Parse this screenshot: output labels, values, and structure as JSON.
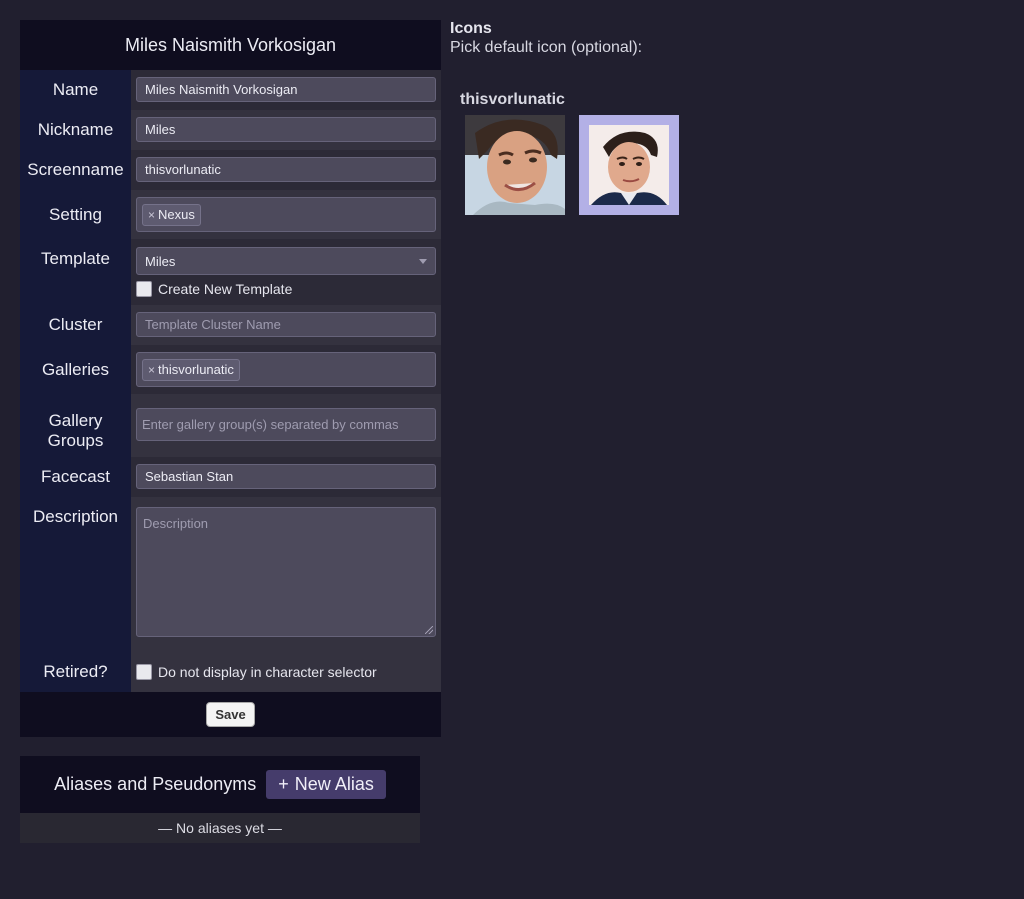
{
  "form": {
    "title": "Miles Naismith Vorkosigan",
    "name": {
      "label": "Name",
      "value": "Miles Naismith Vorkosigan"
    },
    "nickname": {
      "label": "Nickname",
      "value": "Miles"
    },
    "screenname": {
      "label": "Screenname",
      "value": "thisvorlunatic"
    },
    "setting": {
      "label": "Setting",
      "tags": [
        "Nexus"
      ]
    },
    "template": {
      "label": "Template",
      "value": "Miles",
      "create_new_label": "Create New Template"
    },
    "cluster": {
      "label": "Cluster",
      "placeholder": "Template Cluster Name"
    },
    "galleries": {
      "label": "Galleries",
      "tags": [
        "thisvorlunatic"
      ]
    },
    "gallery_groups": {
      "label_line1": "Gallery",
      "label_line2": "Groups",
      "placeholder": "Enter gallery group(s) separated by commas"
    },
    "facecast": {
      "label": "Facecast",
      "value": "Sebastian Stan"
    },
    "description": {
      "label": "Description",
      "placeholder": "Description"
    },
    "retired": {
      "label": "Retired?",
      "checkbox_label": "Do not display in character selector"
    },
    "save_label": "Save",
    "tag_remove_glyph": "×"
  },
  "aliases": {
    "title": "Aliases and Pseudonyms",
    "new_alias_plus": "+",
    "new_alias_label": "New Alias",
    "empty_text": "— No aliases yet —"
  },
  "icons": {
    "title": "Icons",
    "subtitle": "Pick default icon (optional):",
    "gallery_name": "thisvorlunatic",
    "selected_index": 1,
    "tiles": [
      "portrait-icon",
      "portrait-icon"
    ],
    "selected_color": "#b3b0e6"
  },
  "colors": {
    "background": "#211f2f",
    "header": "#0f0d1f",
    "label_column": "#151938",
    "accent_button": "#453c6b"
  }
}
